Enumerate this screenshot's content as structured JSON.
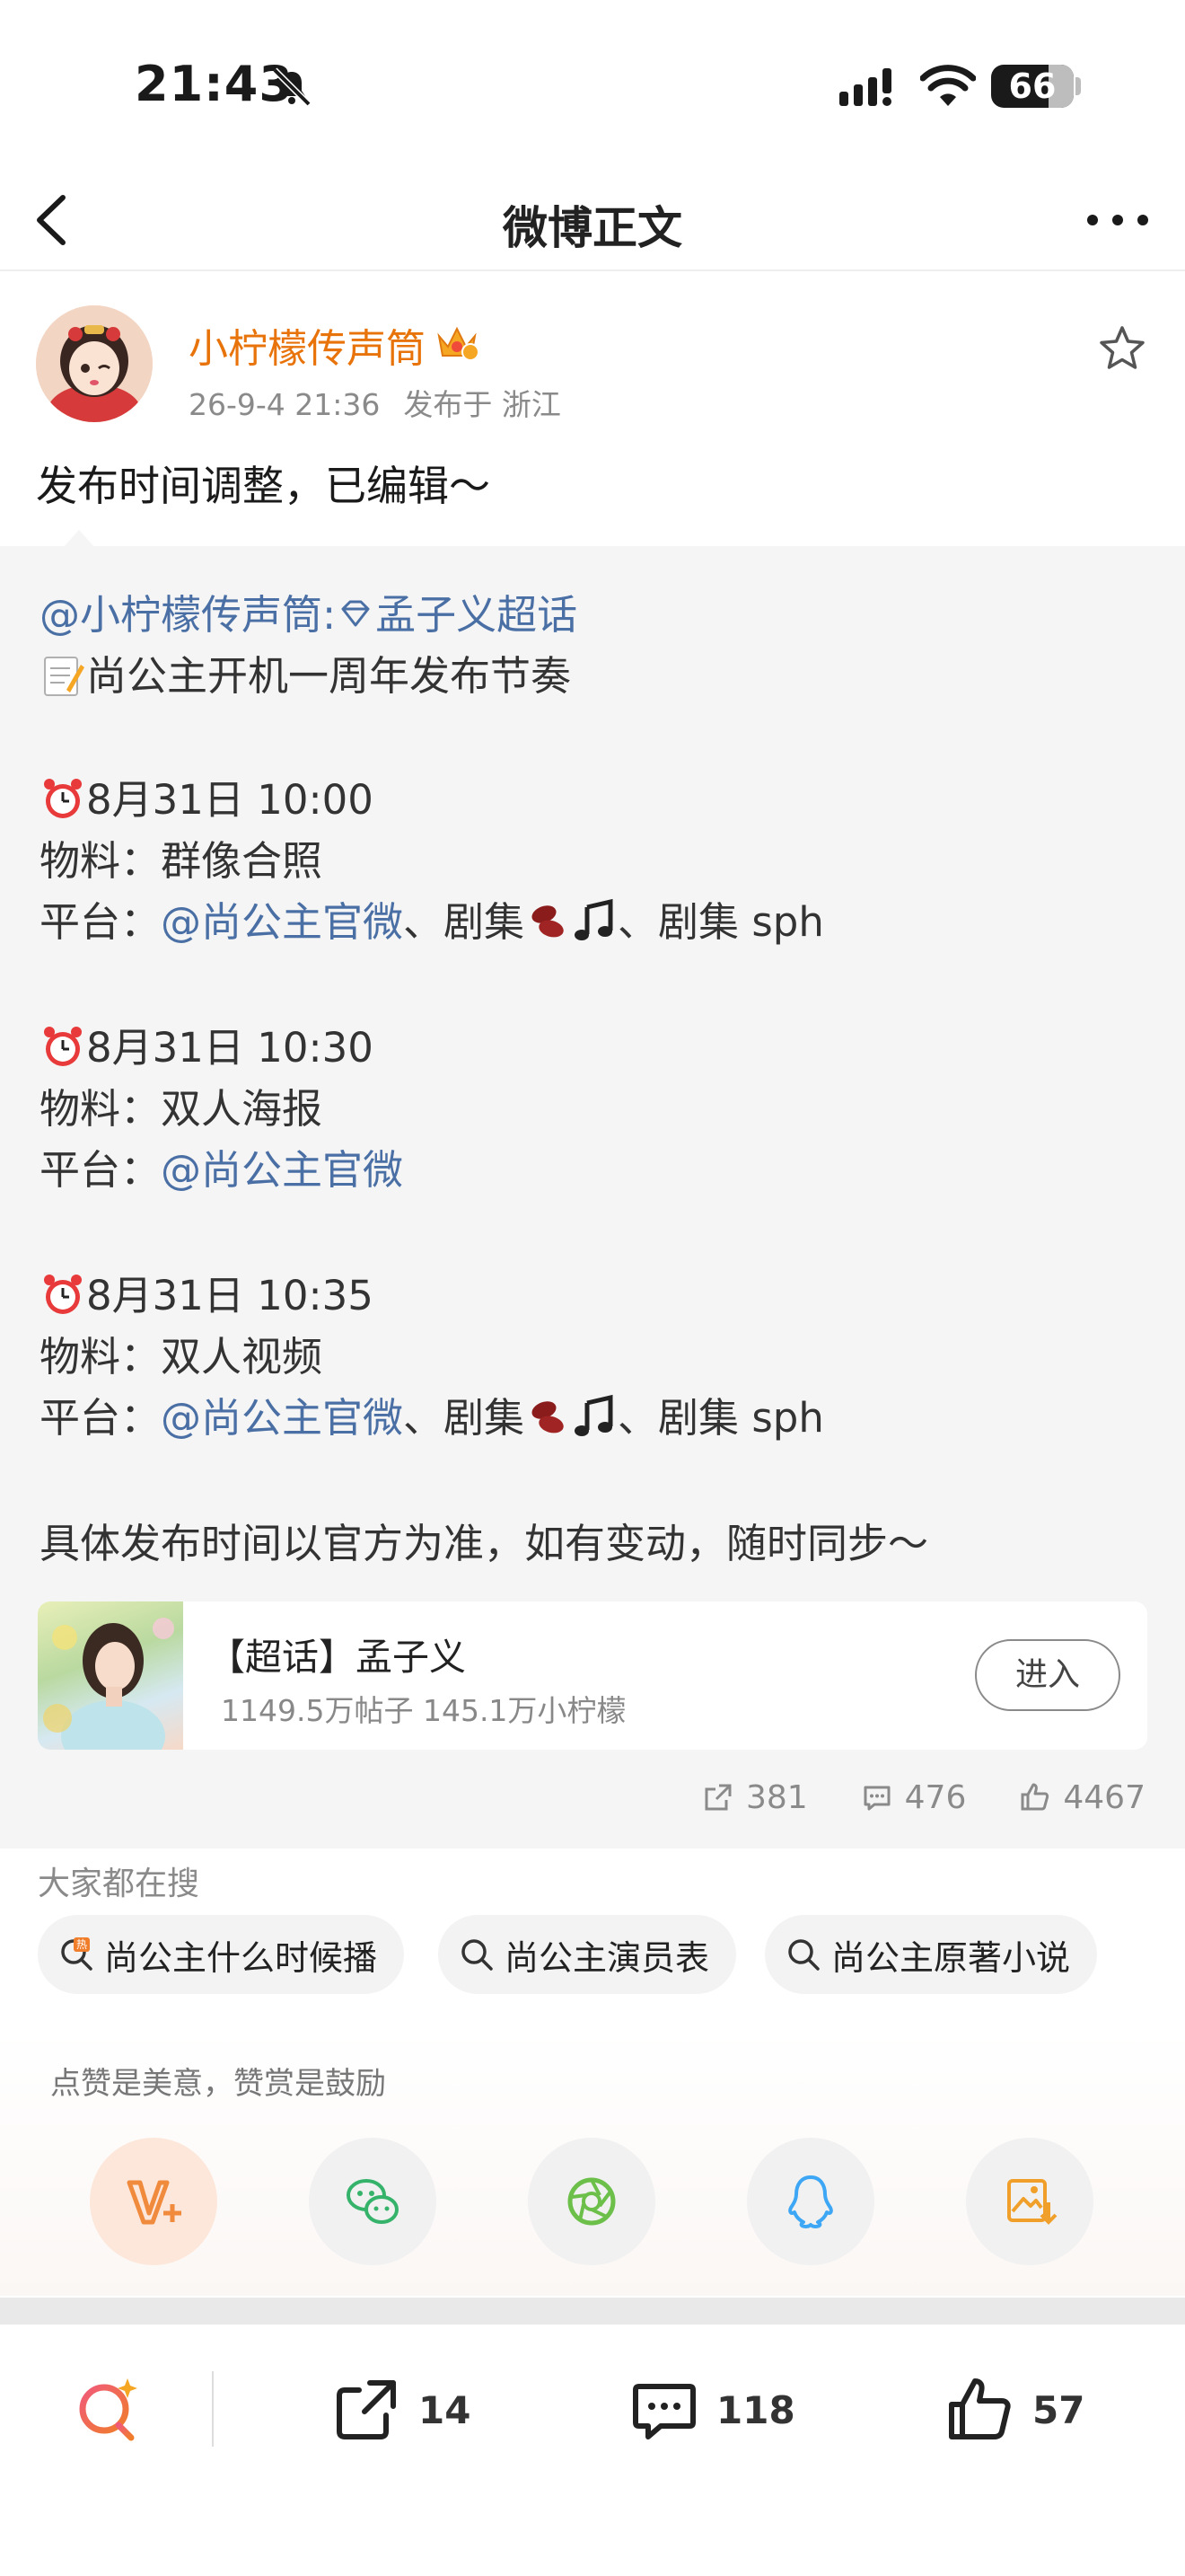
{
  "status_bar": {
    "time": "21:43",
    "battery": "66"
  },
  "nav": {
    "title": "微博正文"
  },
  "post": {
    "author": "小柠檬传声筒",
    "timestamp": "26-9-4 21:36",
    "location": "发布于 浙江",
    "text": "发布时间调整，已编辑～"
  },
  "repost": {
    "mention_source": "@小柠檬传声筒:",
    "supertopic_link": "孟子义超话",
    "headline": "尚公主开机一周年发布节奏",
    "blocks": [
      {
        "time": "8月31日 10:00",
        "material_label": "物料：",
        "material": "群像合照",
        "platform_label": "平台：",
        "platform_mention": "@尚公主官微",
        "platform_rest_1": "、剧集",
        "platform_rest_2": "、剧集 sph"
      },
      {
        "time": "8月31日 10:30",
        "material_label": "物料：",
        "material": "双人海报",
        "platform_label": "平台：",
        "platform_mention": "@尚公主官微"
      },
      {
        "time": "8月31日 10:35",
        "material_label": "物料：",
        "material": "双人视频",
        "platform_label": "平台：",
        "platform_mention": "@尚公主官微",
        "platform_rest_1": "、剧集",
        "platform_rest_2": "、剧集 sph"
      }
    ],
    "note": "具体发布时间以官方为准，如有变动，随时同步～",
    "topic_card": {
      "title": "【超话】孟子义",
      "stats": "1149.5万帖子 145.1万小柠檬",
      "enter_label": "进入"
    },
    "counts": {
      "reposts": "381",
      "comments": "476",
      "likes": "4467"
    }
  },
  "hot_search": {
    "title": "大家都在搜",
    "items": [
      "尚公主什么时候播",
      "尚公主演员表",
      "尚公主原著小说"
    ]
  },
  "reward": {
    "hint": "点赞是美意，赞赏是鼓励"
  },
  "bottom_bar": {
    "reposts": "14",
    "comments": "118",
    "likes": "57"
  },
  "colors": {
    "author": "#e8730a",
    "mention": "#4a6fa5",
    "wechat": "#36b36b",
    "qq": "#3da7f5",
    "reward": "#f08a3c"
  }
}
